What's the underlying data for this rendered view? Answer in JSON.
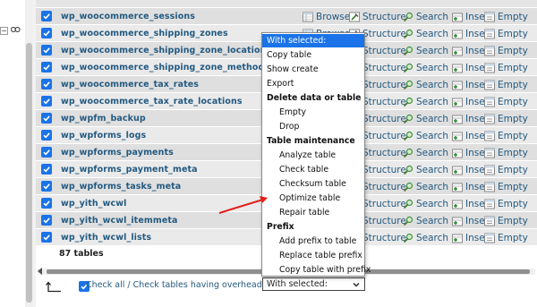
{
  "tables": [
    {
      "name": "wp_woocommerce_sessions"
    },
    {
      "name": "wp_woocommerce_shipping_zones"
    },
    {
      "name": "wp_woocommerce_shipping_zone_locations"
    },
    {
      "name": "wp_woocommerce_shipping_zone_methods"
    },
    {
      "name": "wp_woocommerce_tax_rates"
    },
    {
      "name": "wp_woocommerce_tax_rate_locations"
    },
    {
      "name": "wp_wpfm_backup"
    },
    {
      "name": "wp_wpforms_logs"
    },
    {
      "name": "wp_wpforms_payments"
    },
    {
      "name": "wp_wpforms_payment_meta"
    },
    {
      "name": "wp_wpforms_tasks_meta"
    },
    {
      "name": "wp_yith_wcwl"
    },
    {
      "name": "wp_yith_wcwl_itemmeta"
    },
    {
      "name": "wp_yith_wcwl_lists"
    }
  ],
  "actions": {
    "browse": "Browse",
    "structure": "Structure",
    "search": "Search",
    "insert": "Insert",
    "empty": "Empty"
  },
  "summary": {
    "total": "87 tables"
  },
  "footer": {
    "check_all_label": "Check all / Check tables having overhead",
    "select_value": "With selected:"
  },
  "dropdown": {
    "items": [
      {
        "label": "With selected:",
        "kind": "selected"
      },
      {
        "label": "Copy table",
        "kind": "option"
      },
      {
        "label": "Show create",
        "kind": "option"
      },
      {
        "label": "Export",
        "kind": "option"
      },
      {
        "label": "Delete data or table",
        "kind": "group"
      },
      {
        "label": "Empty",
        "kind": "indent"
      },
      {
        "label": "Drop",
        "kind": "indent"
      },
      {
        "label": "Table maintenance",
        "kind": "group"
      },
      {
        "label": "Analyze table",
        "kind": "indent"
      },
      {
        "label": "Check table",
        "kind": "indent"
      },
      {
        "label": "Checksum table",
        "kind": "indent"
      },
      {
        "label": "Optimize table",
        "kind": "indent"
      },
      {
        "label": "Repair table",
        "kind": "indent"
      },
      {
        "label": "Prefix",
        "kind": "group"
      },
      {
        "label": "Add prefix to table",
        "kind": "indent"
      },
      {
        "label": "Replace table prefix",
        "kind": "indent"
      },
      {
        "label": "Copy table with prefix",
        "kind": "indent"
      }
    ]
  },
  "colors": {
    "link": "#235a81",
    "checkbox": "#1a73e8",
    "row_odd": "#dfdfdf",
    "row_even": "#eaeaea",
    "highlight": "#1a73e8",
    "annotation_arrow": "#e0201b"
  },
  "icons": {
    "favorite": "star-icon",
    "browse": "browse-table-icon",
    "structure": "structure-icon",
    "search": "search-icon",
    "insert": "insert-row-icon",
    "empty": "empty-table-icon",
    "check_all": "arrow-turn-up-icon",
    "select": "chevron-down-icon"
  }
}
